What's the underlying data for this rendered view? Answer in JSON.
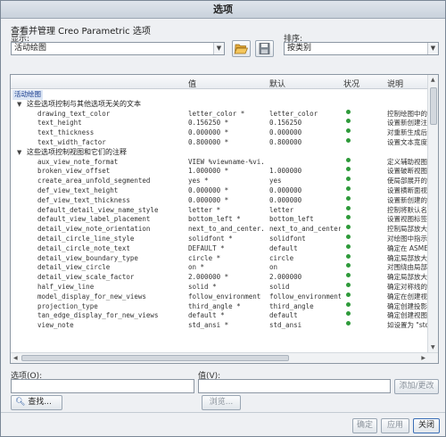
{
  "window": {
    "title": "选项"
  },
  "heading": "查看并管理 Creo Parametric 选项",
  "display": {
    "label": "显示:",
    "value": "活动绘图"
  },
  "sort": {
    "label": "排序:",
    "value": "按类别"
  },
  "columns": {
    "value": "值",
    "default": "默认",
    "status": "状况",
    "desc": "说明"
  },
  "tree": {
    "root": "活动绘图",
    "group1": "这些选项控制与其他选项无关的文本",
    "rows1": [
      {
        "name": "drawing_text_color",
        "value": "letter_color *",
        "default": "letter_color",
        "desc": "控制绘图中的文"
      },
      {
        "name": "text_height",
        "value": "0.156250 *",
        "default": "0.156250",
        "desc": "设置新创建注释"
      },
      {
        "name": "text_thickness",
        "value": "0.000000 *",
        "default": "0.000000",
        "desc": "对重新生成后的"
      },
      {
        "name": "text_width_factor",
        "value": "0.800000 *",
        "default": "0.800000",
        "desc": "设置文本宽度和"
      }
    ],
    "group2": "这些选项控制视图和它们的注释",
    "rows2": [
      {
        "name": "aux_view_note_format",
        "value": "VIEW %viewname-%vi...",
        "default": "",
        "desc": "定义辅助视图注"
      },
      {
        "name": "broken_view_offset",
        "value": "1.000000 *",
        "default": "1.000000",
        "desc": "设置破断视图两"
      },
      {
        "name": "create_area_unfold_segmented",
        "value": "yes *",
        "default": "yes",
        "desc": "使局部展开的横"
      },
      {
        "name": "def_view_text_height",
        "value": "0.000000 *",
        "default": "0.000000",
        "desc": "设置横断面视图"
      },
      {
        "name": "def_view_text_thickness",
        "value": "0.000000 *",
        "default": "0.000000",
        "desc": "设置新创建的横"
      },
      {
        "name": "default_detail_view_name_style",
        "value": "letter *",
        "default": "letter",
        "desc": "控制将默认名称"
      },
      {
        "name": "default_view_label_placement",
        "value": "bottom_left *",
        "default": "bottom_left",
        "desc": "设置视图标签的"
      },
      {
        "name": "detail_view_note_orientation",
        "value": "next_to_and_center...",
        "default": "next_to_and_center...",
        "desc": "控制局部放大图"
      },
      {
        "name": "detail_circle_line_style",
        "value": "solidfont *",
        "default": "solidfont",
        "desc": "对绘图中指示局"
      },
      {
        "name": "detail_circle_note_text",
        "value": "DEFAULT *",
        "default": "default",
        "desc": "确定在 ASME"
      },
      {
        "name": "detail_view_boundary_type",
        "value": "circle *",
        "default": "circle",
        "desc": "确定局部放大图"
      },
      {
        "name": "detail_view_circle",
        "value": "on *",
        "default": "on",
        "desc": "对围绕由局部放"
      },
      {
        "name": "detail_view_scale_factor",
        "value": "2.000000 *",
        "default": "2.000000",
        "desc": "确定局部放大图"
      },
      {
        "name": "half_view_line",
        "value": "solid *",
        "default": "solid",
        "desc": "确定对称线的显"
      },
      {
        "name": "model_display_for_new_views",
        "value": "follow_environment *",
        "default": "follow_environment",
        "desc": "确定在创建视图"
      },
      {
        "name": "projection_type",
        "value": "third_angle *",
        "default": "third_angle",
        "desc": "确定创建投影视"
      },
      {
        "name": "tan_edge_display_for_new_views",
        "value": "default *",
        "default": "default",
        "desc": "确定创建视图时"
      },
      {
        "name": "view_note",
        "value": "std_ansi *",
        "default": "std_ansi",
        "desc": "如设置为 \"std_"
      }
    ]
  },
  "option": {
    "label": "选项(O):"
  },
  "valueField": {
    "label": "值(V):"
  },
  "buttons": {
    "addChange": "添加/更改",
    "find": "查找...",
    "browse": "浏览...",
    "ok": "确定",
    "apply": "应用",
    "close": "关闭"
  },
  "colors": {
    "status_ok": "#2e9a3a",
    "selection": "#dce6f5"
  }
}
